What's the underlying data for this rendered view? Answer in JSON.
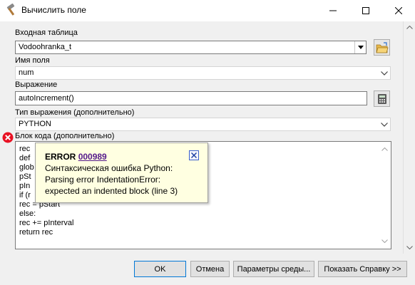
{
  "window": {
    "title": "Вычислить поле"
  },
  "input_table": {
    "label": "Входная таблица",
    "value": "Vodoohranka_t"
  },
  "field_name": {
    "label": "Имя поля",
    "value": "num"
  },
  "expression": {
    "label": "Выражение",
    "value": "autoIncrement()"
  },
  "expression_type": {
    "label": "Тип выражения (дополнительно)",
    "value": "PYTHON"
  },
  "code_block": {
    "label": "Блок кода (дополнительно)",
    "lines": [
      "rec",
      "def",
      "glob",
      "pSt",
      "pIn",
      "if (r",
      "rec = pStart",
      "else:",
      "rec += pInterval",
      "return rec"
    ]
  },
  "error_tip": {
    "title": "ERROR",
    "code": "000989",
    "line1": "Синтаксическая ошибка Python:",
    "line2": "Parsing error IndentationError:",
    "line3": "expected an indented block (line 3)"
  },
  "buttons": {
    "ok": "OK",
    "cancel": "Отмена",
    "environments": "Параметры среды...",
    "show_help": "Показать Справку >>"
  },
  "colors": {
    "accent": "#0078d7",
    "tooltip_bg": "#ffffe1",
    "error": "#e81123",
    "link": "#551a8b"
  }
}
